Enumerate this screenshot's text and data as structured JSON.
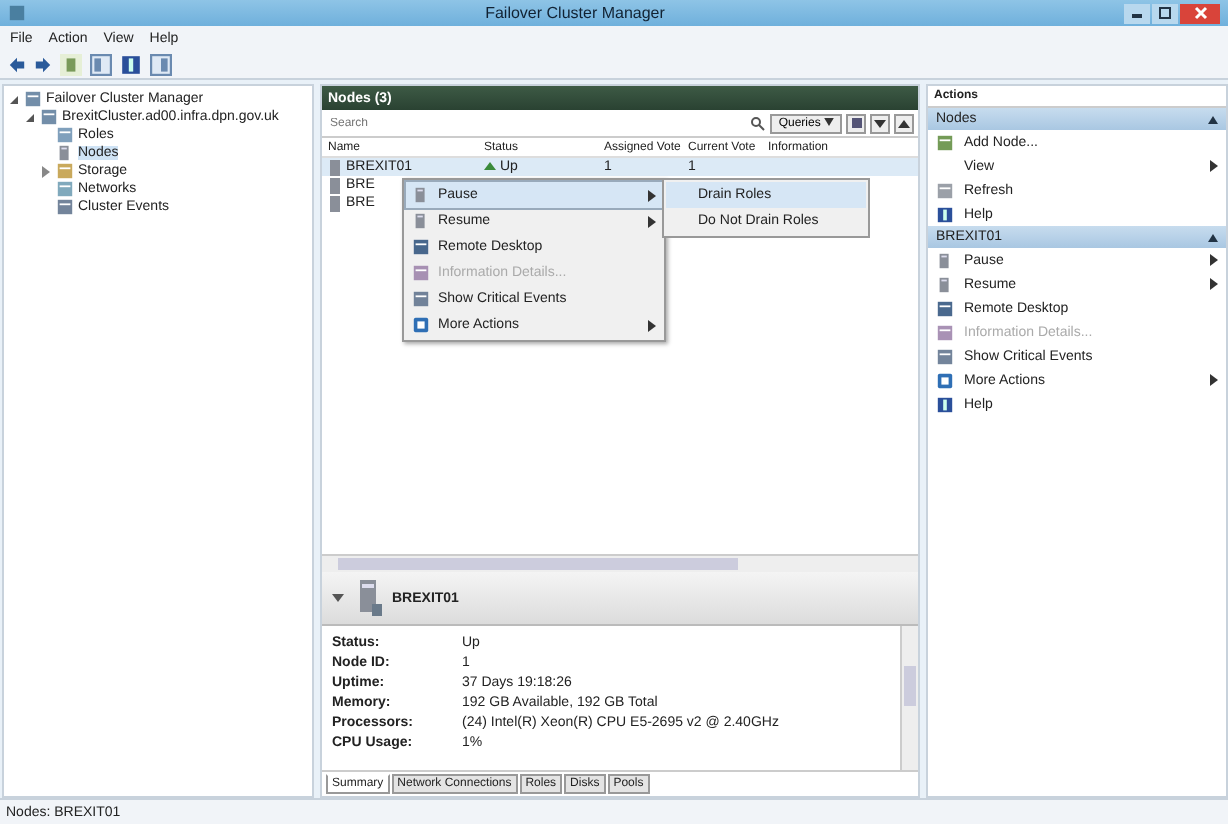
{
  "window": {
    "title": "Failover Cluster Manager"
  },
  "menu": [
    "File",
    "Action",
    "View",
    "Help"
  ],
  "tree": {
    "label": "Failover Cluster Manager",
    "kind": "cluster-manager",
    "expanded": true,
    "selected": false,
    "children": [
      {
        "label": "BrexitCluster.ad00.infra.dpn.gov.uk",
        "kind": "cluster",
        "expanded": true,
        "selected": false,
        "children": [
          {
            "label": "Roles",
            "kind": "roles",
            "selected": false
          },
          {
            "label": "Nodes",
            "kind": "nodes",
            "selected": true
          },
          {
            "label": "Storage",
            "kind": "storage",
            "expanded": false,
            "selected": false
          },
          {
            "label": "Networks",
            "kind": "networks",
            "selected": false
          },
          {
            "label": "Cluster Events",
            "kind": "events",
            "selected": false
          }
        ]
      }
    ]
  },
  "nodes_panel": {
    "title": "Nodes (3)",
    "search": {
      "placeholder": "Search"
    },
    "queries": "Queries",
    "columns": [
      "Name",
      "Status",
      "Assigned Vote",
      "Current Vote",
      "Information"
    ],
    "rows": [
      {
        "name": "BREXIT01",
        "status": "Up",
        "assigned_vote": "1",
        "current_vote": "1",
        "selected": true
      },
      {
        "name": "BRE",
        "status": "",
        "assigned_vote": "",
        "current_vote": "",
        "selected": false
      },
      {
        "name": "BRE",
        "status": "",
        "assigned_vote": "",
        "current_vote": "",
        "selected": false
      }
    ]
  },
  "context_menu": {
    "items": [
      {
        "label": "Pause",
        "kind": "pause",
        "submenu": true,
        "disabled": false,
        "selected": true
      },
      {
        "label": "Resume",
        "kind": "resume",
        "submenu": true,
        "disabled": false,
        "selected": false
      },
      {
        "label": "Remote Desktop",
        "kind": "remote",
        "submenu": false,
        "disabled": false,
        "selected": false
      },
      {
        "label": "Information Details...",
        "kind": "info",
        "submenu": false,
        "disabled": true,
        "selected": false
      },
      {
        "label": "Show Critical Events",
        "kind": "events",
        "submenu": false,
        "disabled": false,
        "selected": false
      },
      {
        "label": "More Actions",
        "kind": "more",
        "submenu": true,
        "disabled": false,
        "selected": false
      }
    ],
    "submenu": [
      "Drain Roles",
      "Do Not Drain Roles"
    ]
  },
  "details": {
    "title": "BREXIT01",
    "properties": [
      {
        "label": "Status:",
        "value": "Up"
      },
      {
        "label": "Node ID:",
        "value": "1"
      },
      {
        "label": "Uptime:",
        "value": "37 Days 19:18:26"
      },
      {
        "label": "Memory:",
        "value": "192 GB Available, 192 GB Total"
      },
      {
        "label": "Processors:",
        "value": "(24) Intel(R) Xeon(R) CPU E5-2695 v2 @ 2.40GHz"
      },
      {
        "label": "CPU Usage:",
        "value": "1%"
      }
    ],
    "tabs": [
      {
        "label": "Summary",
        "selected": true
      },
      {
        "label": "Network Connections",
        "selected": false
      },
      {
        "label": "Roles",
        "selected": false
      },
      {
        "label": "Disks",
        "selected": false
      },
      {
        "label": "Pools",
        "selected": false
      }
    ]
  },
  "actions": {
    "title": "Actions",
    "sections": [
      {
        "title": "Nodes",
        "items": [
          {
            "label": "Add Node...",
            "kind": "add",
            "submenu": false,
            "disabled": false
          },
          {
            "label": "View",
            "kind": "none",
            "submenu": true,
            "disabled": false
          },
          {
            "label": "Refresh",
            "kind": "refresh",
            "submenu": false,
            "disabled": false
          },
          {
            "label": "Help",
            "kind": "help",
            "submenu": false,
            "disabled": false
          }
        ]
      },
      {
        "title": "BREXIT01",
        "items": [
          {
            "label": "Pause",
            "kind": "pause",
            "submenu": true,
            "disabled": false
          },
          {
            "label": "Resume",
            "kind": "resume",
            "submenu": true,
            "disabled": false
          },
          {
            "label": "Remote Desktop",
            "kind": "remote",
            "submenu": false,
            "disabled": false
          },
          {
            "label": "Information Details...",
            "kind": "info",
            "submenu": false,
            "disabled": true
          },
          {
            "label": "Show Critical Events",
            "kind": "events",
            "submenu": false,
            "disabled": false
          },
          {
            "label": "More Actions",
            "kind": "more",
            "submenu": true,
            "disabled": false
          },
          {
            "label": "Help",
            "kind": "help",
            "submenu": false,
            "disabled": false
          }
        ]
      }
    ]
  },
  "status_bar": "Nodes: BREXIT01"
}
